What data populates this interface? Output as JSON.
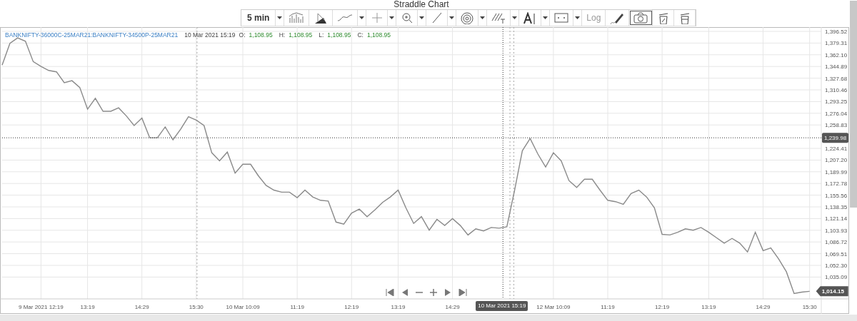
{
  "title": "Straddle Chart",
  "toolbar": {
    "interval": "5 min",
    "log_label": "Log",
    "camera_pressed": true
  },
  "legend": {
    "time": "10 Mar 2021 15:19",
    "fields": [
      {
        "label": "O:",
        "value": "1,108.95"
      },
      {
        "label": "H:",
        "value": "1,108.95"
      },
      {
        "label": "L:",
        "value": "1,108.95"
      },
      {
        "label": "C:",
        "value": "1,108.95"
      }
    ]
  },
  "crosshair": {
    "time": "10 Mar 2021 15:19"
  },
  "chart_data": {
    "type": "line",
    "grid": true,
    "ylim": [
      1003,
      1402.8
    ],
    "categories": [
      null,
      null,
      null,
      null,
      null,
      "9 Mar 2021 12:19",
      null,
      null,
      null,
      null,
      null,
      "13:19",
      null,
      null,
      null,
      null,
      null,
      null,
      "14:29",
      null,
      null,
      null,
      null,
      null,
      null,
      "15:30",
      null,
      null,
      null,
      null,
      null,
      "10 Mar 10:09",
      null,
      null,
      null,
      null,
      null,
      null,
      "11:19",
      null,
      null,
      null,
      null,
      null,
      null,
      "12:19",
      null,
      null,
      null,
      null,
      null,
      "13:19",
      null,
      null,
      null,
      null,
      null,
      null,
      "14:29",
      null,
      null,
      null,
      null,
      null,
      null,
      null,
      null,
      null,
      null,
      null,
      null,
      "12 Mar 10:09",
      null,
      null,
      null,
      null,
      null,
      null,
      "11:19",
      null,
      null,
      null,
      null,
      null,
      null,
      "12:19",
      null,
      null,
      null,
      null,
      null,
      "13:19",
      null,
      null,
      null,
      null,
      null,
      null,
      "14:29",
      null,
      null,
      null,
      null,
      null,
      "15:30"
    ],
    "series": [
      {
        "name": "BANKNIFTY-36000C-25MAR21:BANKNIFTY-34500P-25MAR21",
        "color": "#8a8a8a",
        "values": [
          1347,
          1379,
          1387,
          1382,
          1352,
          1345,
          1339,
          1337,
          1321,
          1324,
          1314,
          1282,
          1298,
          1279,
          1279,
          1284,
          1272,
          1258,
          1269,
          1240,
          1240,
          1256,
          1237,
          1253,
          1271,
          1266,
          1258,
          1218,
          1206,
          1219,
          1188,
          1201,
          1201,
          1184,
          1170,
          1163,
          1160,
          1160,
          1152,
          1163,
          1153,
          1148,
          1147,
          1116,
          1113,
          1129,
          1135,
          1124,
          1134,
          1145,
          1153,
          1163,
          1137,
          1114,
          1124,
          1104,
          1120,
          1111,
          1121,
          1111,
          1097,
          1106,
          1103,
          1108,
          1107,
          1109,
          1163,
          1221,
          1239,
          1216,
          1197,
          1218,
          1206,
          1177,
          1167,
          1179,
          1179,
          1163,
          1148,
          1146,
          1142,
          1158,
          1163,
          1153,
          1137,
          1098,
          1097,
          1101,
          1106,
          1104,
          1108,
          1101,
          1093,
          1085,
          1092,
          1085,
          1072,
          1101,
          1074,
          1078,
          1062,
          1043,
          1011,
          1013,
          1014.15
        ]
      }
    ],
    "yticks": [
      {
        "value": 1396.52,
        "label": "1,396.52"
      },
      {
        "value": 1379.31,
        "label": "1,379.31"
      },
      {
        "value": 1362.1,
        "label": "1,362.10"
      },
      {
        "value": 1344.89,
        "label": "1,344.89"
      },
      {
        "value": 1327.68,
        "label": "1,327.68"
      },
      {
        "value": 1310.46,
        "label": "1,310.46"
      },
      {
        "value": 1293.25,
        "label": "1,293.25"
      },
      {
        "value": 1276.04,
        "label": "1,276.04"
      },
      {
        "value": 1258.83,
        "label": "1,258.83"
      },
      {
        "value": 1224.41,
        "label": "1,224.41"
      },
      {
        "value": 1207.2,
        "label": "1,207.20"
      },
      {
        "value": 1189.99,
        "label": "1,189.99"
      },
      {
        "value": 1172.78,
        "label": "1,172.78"
      },
      {
        "value": 1155.56,
        "label": "1,155.56"
      },
      {
        "value": 1138.35,
        "label": "1,138.35"
      },
      {
        "value": 1121.14,
        "label": "1,121.14"
      },
      {
        "value": 1103.93,
        "label": "1,103.93"
      },
      {
        "value": 1086.72,
        "label": "1,086.72"
      },
      {
        "value": 1069.51,
        "label": "1,069.51"
      },
      {
        "value": 1052.3,
        "label": "1,052.30"
      },
      {
        "value": 1035.09,
        "label": "1,035.09"
      }
    ],
    "ref_lines": [
      {
        "axis": "y",
        "value": 1239.98,
        "label": "1,239.98"
      }
    ],
    "annotations": [
      "1,014.15"
    ]
  }
}
